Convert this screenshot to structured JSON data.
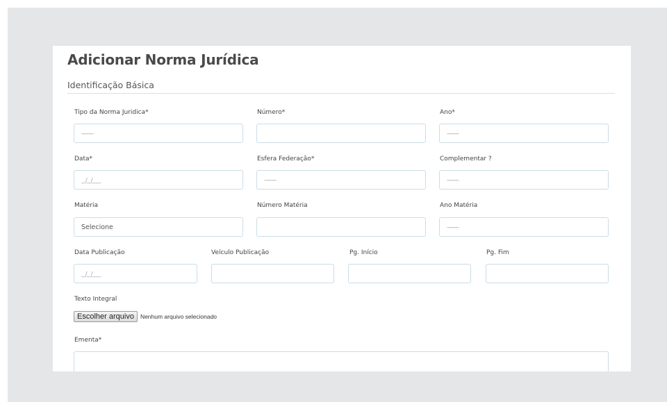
{
  "page": {
    "title": "Adicionar Norma Jurídica",
    "section": "Identificação Básica"
  },
  "form": {
    "tipo": {
      "label": "Tipo da Norma Juridica*",
      "value": "---------"
    },
    "numero": {
      "label": "Número*",
      "value": ""
    },
    "ano": {
      "label": "Ano*",
      "value": "---------"
    },
    "data": {
      "label": "Data*",
      "value": "__/__/____"
    },
    "esfera": {
      "label": "Esfera Federação*",
      "value": "---------"
    },
    "complementar": {
      "label": "Complementar ?",
      "value": "---------"
    },
    "materia": {
      "label": "Matéria",
      "value": "Selecione"
    },
    "numero_materia": {
      "label": "Número Matéria",
      "value": ""
    },
    "ano_materia": {
      "label": "Ano Matéria",
      "value": "---------"
    },
    "data_publicacao": {
      "label": "Data Publicação",
      "value": "__/__/____"
    },
    "veiculo_publicacao": {
      "label": "Veículo Publicação",
      "value": ""
    },
    "pg_inicio": {
      "label": "Pg. Início",
      "value": ""
    },
    "pg_fim": {
      "label": "Pg. Fim",
      "value": ""
    },
    "texto_integral": {
      "label": "Texto Integral",
      "button_label": "Escolher arquivo",
      "status": "Nenhum arquivo selecionado"
    },
    "ementa": {
      "label": "Ementa*",
      "value": ""
    }
  }
}
